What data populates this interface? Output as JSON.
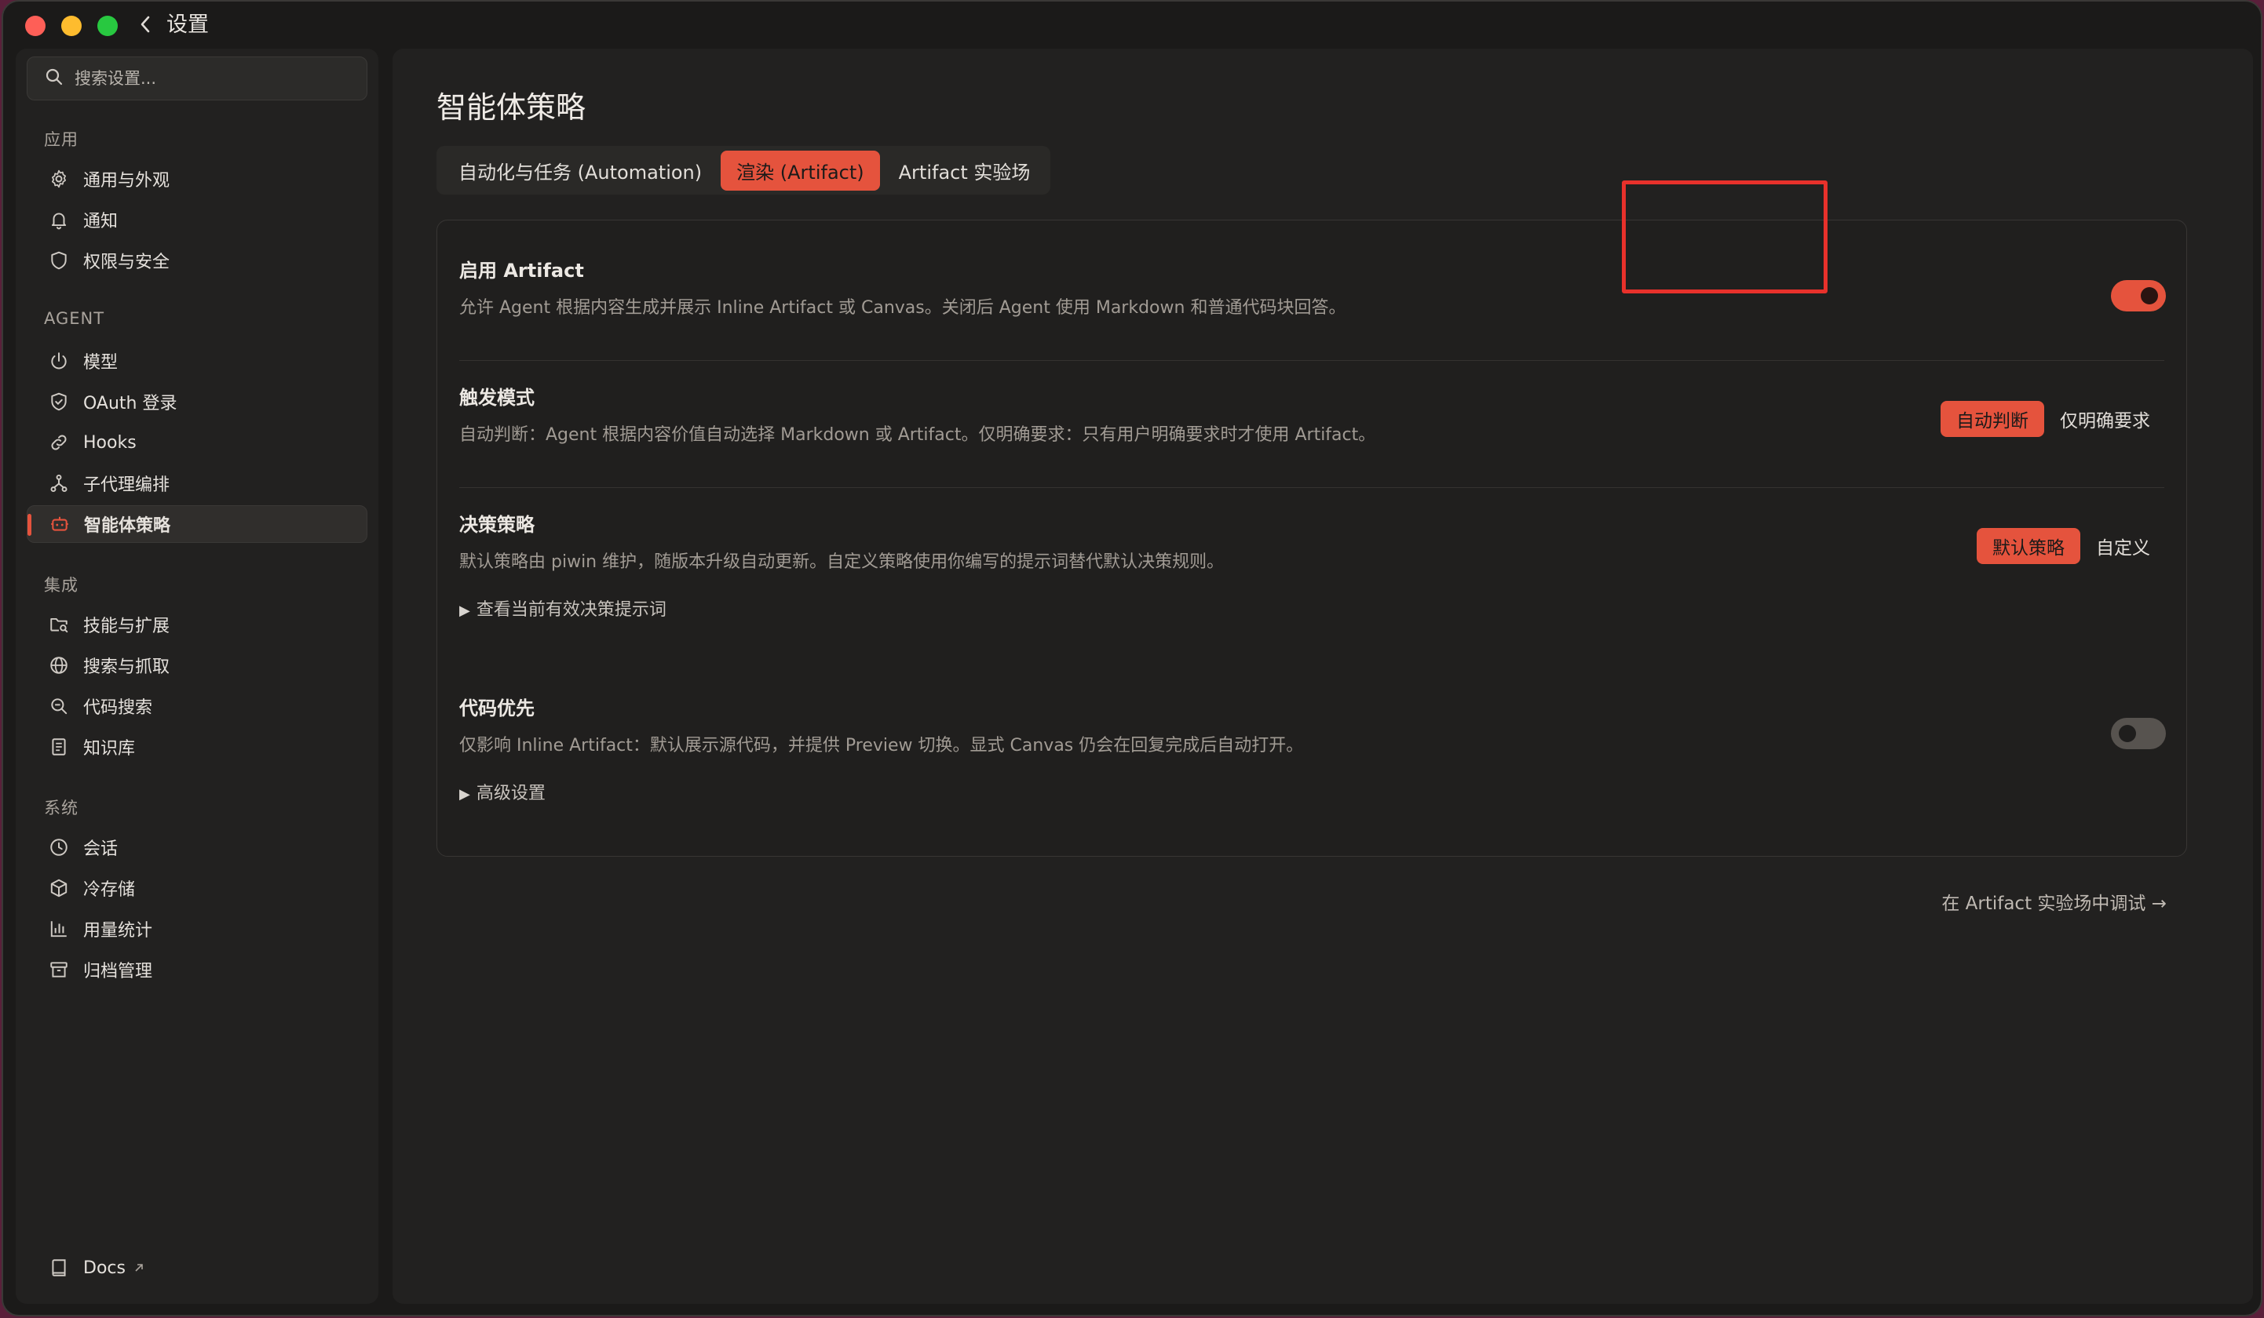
{
  "window": {
    "title": "设置"
  },
  "sidebar": {
    "search_placeholder": "搜索设置...",
    "sections": [
      {
        "label": "应用",
        "items": [
          {
            "label": "通用与外观",
            "icon": "gear-icon"
          },
          {
            "label": "通知",
            "icon": "bell-icon"
          },
          {
            "label": "权限与安全",
            "icon": "shield-icon"
          }
        ]
      },
      {
        "label": "AGENT",
        "items": [
          {
            "label": "模型",
            "icon": "power-icon"
          },
          {
            "label": "OAuth 登录",
            "icon": "shield-check-icon"
          },
          {
            "label": "Hooks",
            "icon": "link-icon"
          },
          {
            "label": "子代理编排",
            "icon": "branch-icon"
          },
          {
            "label": "智能体策略",
            "icon": "robot-icon",
            "active": true
          }
        ]
      },
      {
        "label": "集成",
        "items": [
          {
            "label": "技能与扩展",
            "icon": "folder-search-icon"
          },
          {
            "label": "搜索与抓取",
            "icon": "globe-icon"
          },
          {
            "label": "代码搜索",
            "icon": "zoom-code-icon"
          },
          {
            "label": "知识库",
            "icon": "notebook-icon"
          }
        ]
      },
      {
        "label": "系统",
        "items": [
          {
            "label": "会话",
            "icon": "clock-icon"
          },
          {
            "label": "冷存储",
            "icon": "cube-icon"
          },
          {
            "label": "用量统计",
            "icon": "bar-chart-icon"
          },
          {
            "label": "归档管理",
            "icon": "archive-icon"
          }
        ]
      }
    ],
    "docs_label": "Docs"
  },
  "main": {
    "title": "智能体策略",
    "tabs": [
      {
        "label": "自动化与任务 (Automation)"
      },
      {
        "label": "渲染 (Artifact)",
        "active": true
      },
      {
        "label": "Artifact 实验场"
      }
    ],
    "settings": {
      "enable_artifact": {
        "title": "启用 Artifact",
        "desc": "允许 Agent 根据内容生成并展示 Inline Artifact 或 Canvas。关闭后 Agent 使用 Markdown 和普通代码块回答。",
        "enabled": true
      },
      "trigger_mode": {
        "title": "触发模式",
        "desc": "自动判断：Agent 根据内容价值自动选择 Markdown 或 Artifact。仅明确要求：只有用户明确要求时才使用 Artifact。",
        "options": [
          "自动判断",
          "仅明确要求"
        ],
        "selected": "自动判断"
      },
      "decision_strategy": {
        "title": "决策策略",
        "desc": "默认策略由 piwin 维护，随版本升级自动更新。自定义策略使用你编写的提示词替代默认决策规则。",
        "options": [
          "默认策略",
          "自定义"
        ],
        "selected": "默认策略",
        "disclosure": "查看当前有效决策提示词"
      },
      "code_first": {
        "title": "代码优先",
        "desc": "仅影响 Inline Artifact：默认展示源代码，并提供 Preview 切换。显式 Canvas 仍会在回复完成后自动打开。",
        "enabled": false
      },
      "advanced": {
        "disclosure": "高级设置"
      }
    },
    "footer_link": "在 Artifact 实验场中调试 →"
  },
  "colors": {
    "accent": "#e5533d",
    "background": "#1b1a19",
    "panel": "#222120",
    "highlight_box": "#e8312b"
  }
}
